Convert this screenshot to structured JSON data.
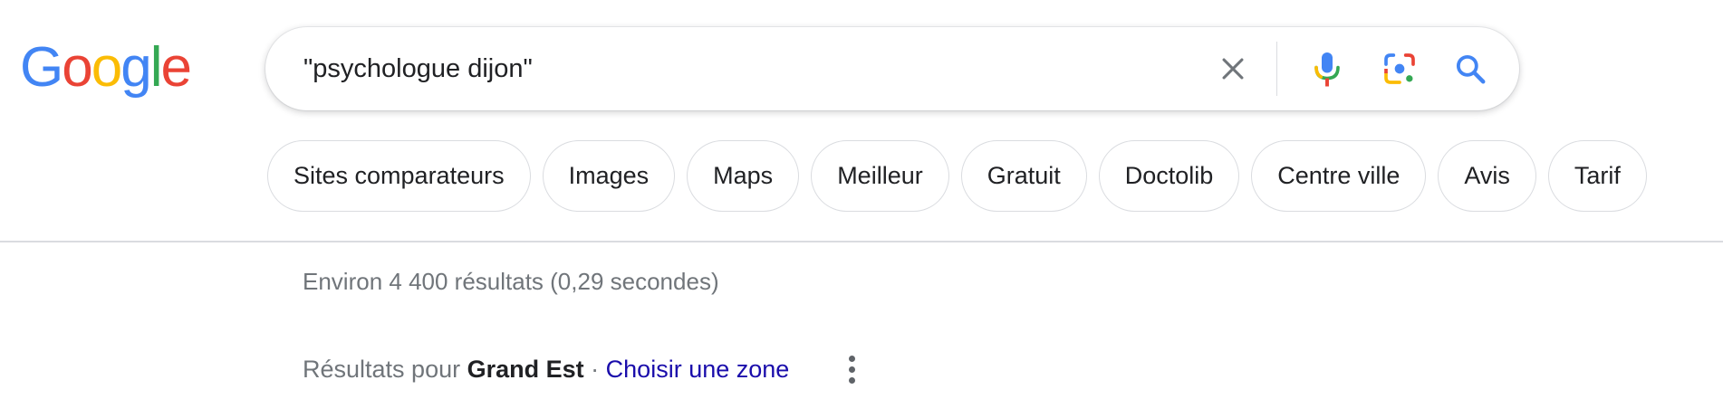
{
  "logo": {
    "letters": [
      {
        "char": "G",
        "color": "#4285F4"
      },
      {
        "char": "o",
        "color": "#EA4335"
      },
      {
        "char": "o",
        "color": "#FBBC05"
      },
      {
        "char": "g",
        "color": "#4285F4"
      },
      {
        "char": "l",
        "color": "#34A853"
      },
      {
        "char": "e",
        "color": "#EA4335"
      }
    ]
  },
  "search": {
    "value": "\"psychologue dijon\"",
    "clear_icon": "close-icon",
    "mic_icon": "mic-icon",
    "lens_icon": "camera-lens-icon",
    "search_icon": "search-icon"
  },
  "chips": [
    "Sites comparateurs",
    "Images",
    "Maps",
    "Meilleur",
    "Gratuit",
    "Doctolib",
    "Centre ville",
    "Avis",
    "Tarif"
  ],
  "results": {
    "stats": "Environ 4 400 résultats (0,29 secondes)",
    "region_prefix": "Résultats pour",
    "region_name": "Grand Est",
    "region_separator": "·",
    "region_link": "Choisir une zone"
  },
  "colors": {
    "blue": "#4285F4",
    "red": "#EA4335",
    "yellow": "#FBBC05",
    "green": "#34A853",
    "link": "#1a0dab"
  }
}
